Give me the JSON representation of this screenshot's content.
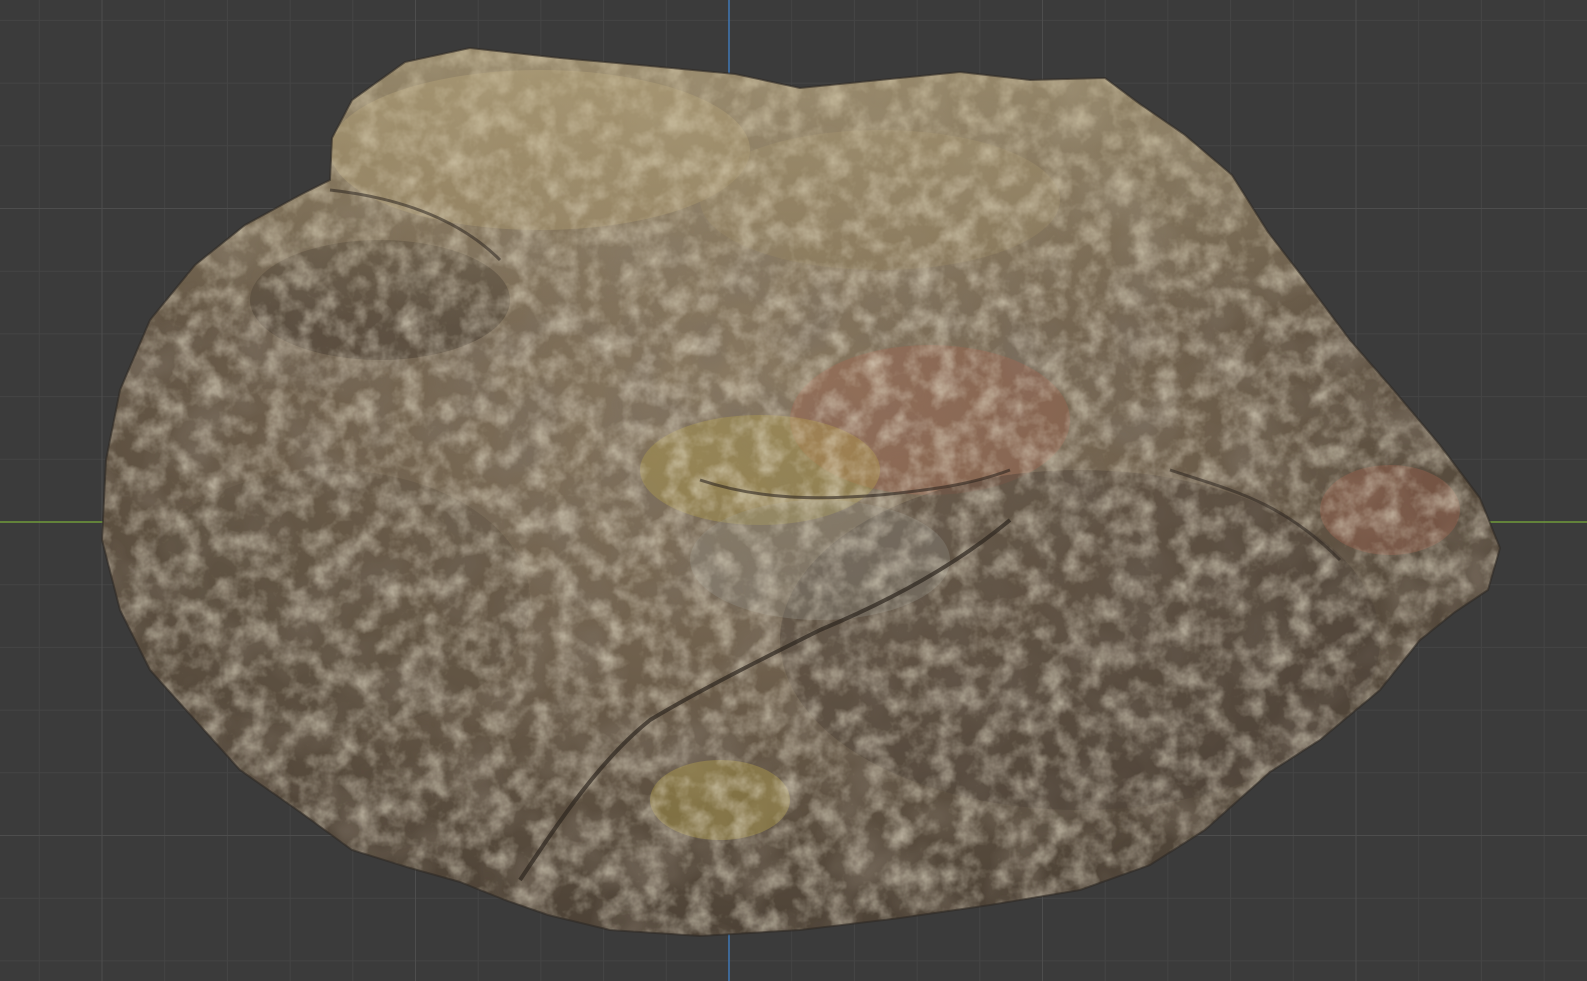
{
  "viewport": {
    "type": "3d-viewport",
    "background_color": "#3b3b3b",
    "grid_minor_color": "#454545",
    "grid_major_color": "#4d4d4d",
    "x_axis_color": "#6f9a3a",
    "y_axis_color": "#3f77b5",
    "grid_visible": true,
    "object": {
      "name_visible": false,
      "kind": "rock-model",
      "base_color": "#6e5f4c",
      "highlight_color": "#b9ad8a",
      "shadow_color": "#3d342b",
      "accent_colors": [
        "#a6893e",
        "#b9a64a",
        "#a9654f",
        "#8f8f8a"
      ]
    }
  }
}
